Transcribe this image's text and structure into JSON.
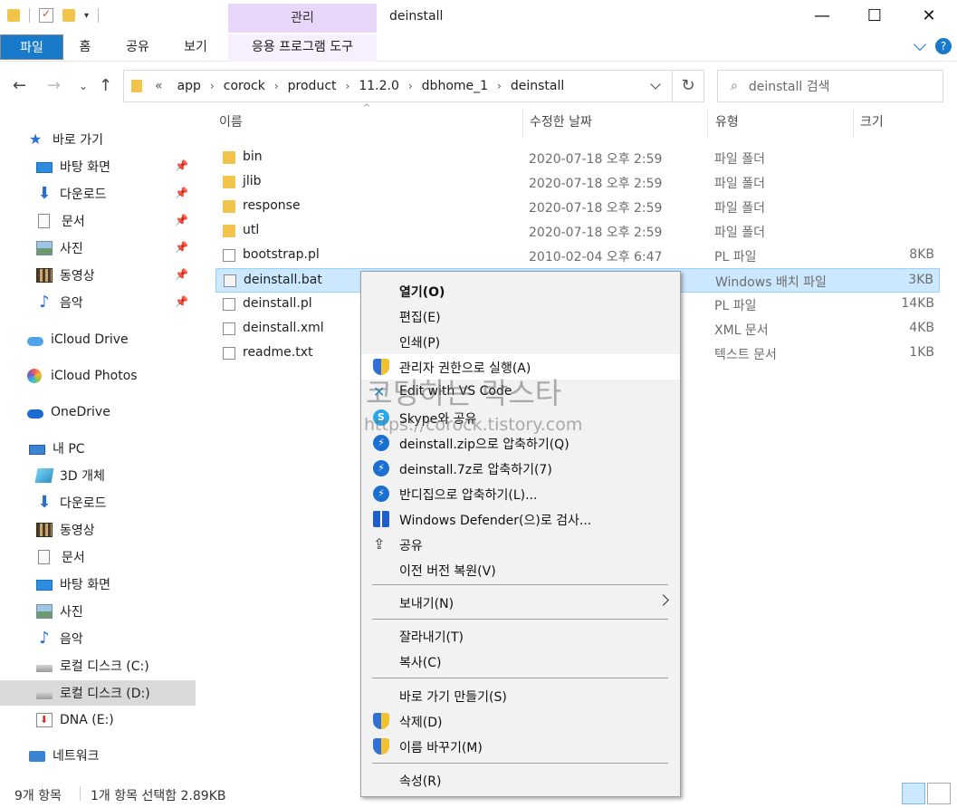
{
  "titlebar": {
    "context_tab": "관리",
    "window_title": "deinstall",
    "minimize": "—",
    "maximize": "☐",
    "close": "✕"
  },
  "ribbon": {
    "tabs": [
      "파일",
      "홈",
      "공유",
      "보기"
    ],
    "context_subtab": "응용 프로그램 도구",
    "help": "?"
  },
  "address": {
    "overflow": "«",
    "crumbs": [
      "app",
      "corock",
      "product",
      "11.2.0",
      "dbhome_1",
      "deinstall"
    ],
    "search_placeholder": "deinstall 검색"
  },
  "navpane": {
    "quick_access": "바로 가기",
    "quick_items": [
      "바탕 화면",
      "다운로드",
      "문서",
      "사진",
      "동영상",
      "음악"
    ],
    "icloud_drive": "iCloud Drive",
    "icloud_photos": "iCloud Photos",
    "onedrive": "OneDrive",
    "this_pc": "내 PC",
    "pc_items": [
      "3D 개체",
      "다운로드",
      "동영상",
      "문서",
      "바탕 화면",
      "사진",
      "음악",
      "로컬 디스크 (C:)",
      "로컬 디스크 (D:)",
      "DNA (E:)"
    ],
    "network": "네트워크"
  },
  "columns": {
    "name": "이름",
    "date": "수정한 날짜",
    "type": "유형",
    "size": "크기"
  },
  "files": [
    {
      "name": "bin",
      "date": "2020-07-18 오후 2:59",
      "type": "파일 폴더",
      "size": ""
    },
    {
      "name": "jlib",
      "date": "2020-07-18 오후 2:59",
      "type": "파일 폴더",
      "size": ""
    },
    {
      "name": "response",
      "date": "2020-07-18 오후 2:59",
      "type": "파일 폴더",
      "size": ""
    },
    {
      "name": "utl",
      "date": "2020-07-18 오후 2:59",
      "type": "파일 폴더",
      "size": ""
    },
    {
      "name": "bootstrap.pl",
      "date": "2010-02-04 오후 6:47",
      "type": "PL 파일",
      "size": "8KB"
    },
    {
      "name": "deinstall.bat",
      "date": "",
      "type": "Windows 배치 파일",
      "size": "3KB"
    },
    {
      "name": "deinstall.pl",
      "date": "",
      "type": "PL 파일",
      "size": "14KB"
    },
    {
      "name": "deinstall.xml",
      "date": "",
      "type": "XML 문서",
      "size": "4KB"
    },
    {
      "name": "readme.txt",
      "date": "",
      "type": "텍스트 문서",
      "size": "1KB"
    }
  ],
  "status": {
    "item_count": "9개 항목",
    "selection": "1개 항목 선택함 2.89KB"
  },
  "context_menu": {
    "open": "열기(O)",
    "edit": "편집(E)",
    "print": "인쇄(P)",
    "run_as_admin": "관리자 권한으로 실행(A)",
    "vscode": "Edit with VS Code",
    "skype": "Skype와 공유",
    "zip": "deinstall.zip으로 압축하기(Q)",
    "sevenz": "deinstall.7z로 압축하기(7)",
    "bandizip": "반디집으로 압축하기(L)...",
    "defender": "Windows Defender(으)로 검사...",
    "share": "공유",
    "restore": "이전 버전 복원(V)",
    "send_to": "보내기(N)",
    "cut": "잘라내기(T)",
    "copy": "복사(C)",
    "shortcut": "바로 가기 만들기(S)",
    "delete": "삭제(D)",
    "rename": "이름 바꾸기(M)",
    "properties": "속성(R)"
  },
  "watermark": {
    "title": "코딩하는 락스타",
    "url": "https://corock.tistory.com"
  }
}
